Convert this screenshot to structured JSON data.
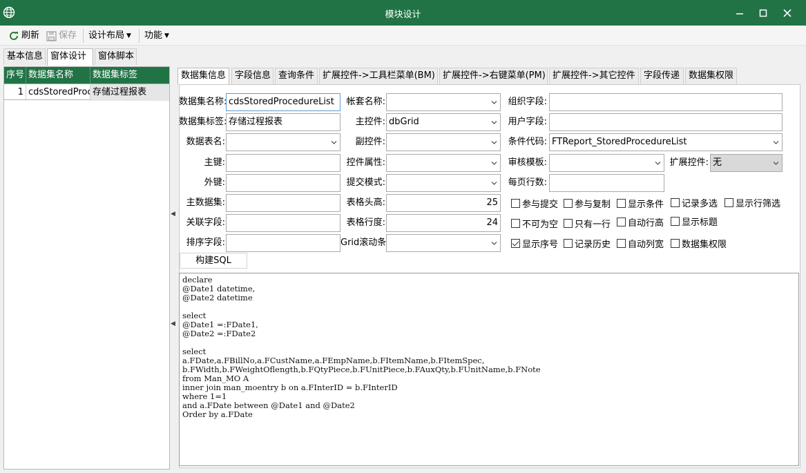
{
  "window": {
    "title": "模块设计",
    "controls": [
      "minimize-icon",
      "maximize-icon",
      "close-icon"
    ]
  },
  "toolbar": {
    "refresh": "刷新",
    "save": "保存",
    "layout": "设计布局",
    "functions": "功能"
  },
  "main_tabs": [
    "基本信息",
    "窗体设计",
    "窗体脚本"
  ],
  "dataset_grid": {
    "headers": [
      "序号",
      "数据集名称",
      "数据集标签"
    ],
    "rows": [
      {
        "no": "1",
        "name": "cdsStoredProcedureList",
        "label": "存储过程报表"
      }
    ]
  },
  "sub_tabs": [
    "数据集信息",
    "字段信息",
    "查询条件",
    "扩展控件->工具栏菜单(BM)",
    "扩展控件->右键菜单(PM)",
    "扩展控件->其它控件",
    "字段传递",
    "数据集权限"
  ],
  "form": {
    "col1": {
      "labels": [
        "数据集名称:",
        "数据集标签:",
        "数据表名:",
        "主键:",
        "外键:",
        "主数据集:",
        "关联字段:",
        "排序字段:"
      ],
      "values": [
        "cdsStoredProcedureList",
        "存储过程报表",
        "",
        "",
        "",
        "",
        "",
        ""
      ]
    },
    "col2": {
      "labels": [
        "帐套名称:",
        "主控件:",
        "副控件:",
        "控件属性:",
        "提交模式:",
        "表格头高:",
        "表格行度:",
        "Grid滚动条:"
      ],
      "values": [
        "",
        "dbGrid",
        "",
        "",
        "",
        "25",
        "24",
        ""
      ]
    },
    "col3": {
      "labels": [
        "组织字段:",
        "用户字段:",
        "条件代码:",
        "审核模板:",
        "每页行数:"
      ],
      "values": [
        "",
        "",
        "FTReport_StoredProcedureList",
        "",
        ""
      ]
    },
    "extension": {
      "label": "扩展控件:",
      "value": "无"
    },
    "checkboxes": [
      [
        {
          "label": "参与提交",
          "checked": false
        },
        {
          "label": "参与复制",
          "checked": false
        },
        {
          "label": "显示条件",
          "checked": false
        },
        {
          "label": "记录多选",
          "checked": false
        },
        {
          "label": "显示行筛选",
          "checked": false
        }
      ],
      [
        {
          "label": "不可为空",
          "checked": false
        },
        {
          "label": "只有一行",
          "checked": false
        },
        {
          "label": "自动行高",
          "checked": false
        },
        {
          "label": "显示标题",
          "checked": false
        }
      ],
      [
        {
          "label": "显示序号",
          "checked": true
        },
        {
          "label": "记录历史",
          "checked": false
        },
        {
          "label": "自动列宽",
          "checked": false
        },
        {
          "label": "数据集权限",
          "checked": false
        }
      ]
    ],
    "build_sql": "构建SQL"
  },
  "sql": "declare\n@Date1 datetime,\n@Date2 datetime\n\nselect\n@Date1 =:FDate1,\n@Date2 =:FDate2\n\nselect\na.FDate,a.FBillNo,a.FCustName,a.FEmpName,b.FItemName,b.FItemSpec,\nb.FWidth,b.FWeightOflength,b.FQtyPiece,b.FUnitPiece,b.FAuxQty,b.FUnitName,b.FNote\nfrom Man_MO A\ninner join man_moentry b on a.FInterID = b.FInterID\nwhere 1=1\nand a.FDate between @Date1 and @Date2\nOrder by a.FDate"
}
